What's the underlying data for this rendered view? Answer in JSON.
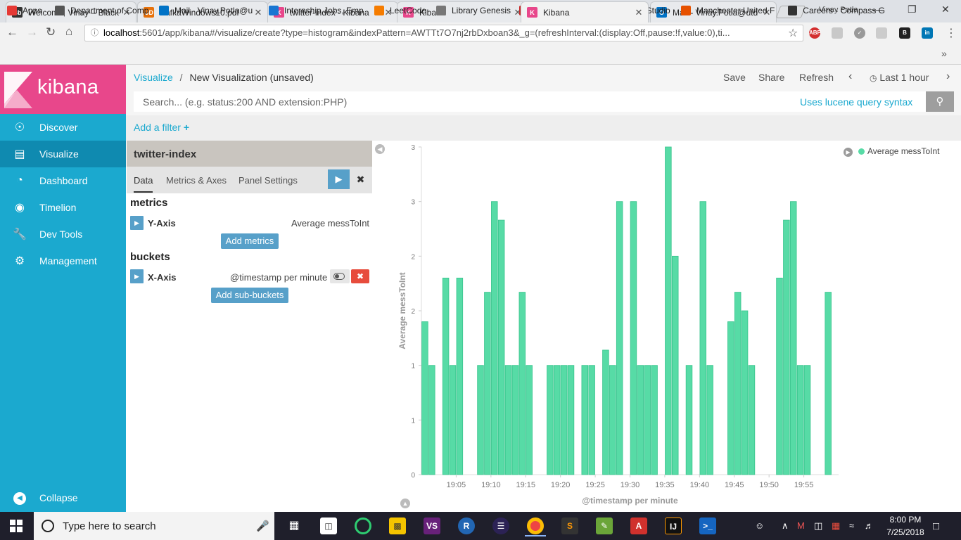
{
  "browser": {
    "tabs": [
      {
        "title": "Welcome, Vinay – Black",
        "icon": "Bb",
        "color": "#333333"
      },
      {
        "title": "KafkaWindows10.pdf",
        "icon": "UD",
        "color": "#e8710a"
      },
      {
        "title": "twitter-index - Kibana",
        "icon": "K",
        "color": "#e8478b"
      },
      {
        "title": "Kibana",
        "icon": "K",
        "color": "#e8478b"
      },
      {
        "title": "Kibana",
        "icon": "K",
        "color": "#e8478b"
      },
      {
        "title": "Mail - Vinay.Potla@utd",
        "icon": "O",
        "color": "#0072c6"
      }
    ],
    "profile_name": "Vinay Potla",
    "url_host": "localhost",
    "url_rest": ":5601/app/kibana#/visualize/create?type=histogram&indexPattern=AWTTt7O7nj2rbDxboan3&_g=(refreshInterval:(display:Off,pause:!f,value:0),ti...",
    "bookmarks": [
      {
        "label": "Apps"
      },
      {
        "label": "Department of Comp"
      },
      {
        "label": "Mail - Vinay.Potla@u"
      },
      {
        "label": "Internship Jobs, Emp"
      },
      {
        "label": "LeetCode"
      },
      {
        "label": "Library Genesis"
      },
      {
        "label": "Online Courses - Any"
      },
      {
        "label": "RStudio"
      },
      {
        "label": "Manchester United F"
      },
      {
        "label": "Careers - Compass G"
      }
    ]
  },
  "kibana": {
    "logo_text": "kibana",
    "nav": [
      {
        "label": "Discover",
        "icon": "compass-icon"
      },
      {
        "label": "Visualize",
        "icon": "bar-chart-icon"
      },
      {
        "label": "Dashboard",
        "icon": "dashboard-icon"
      },
      {
        "label": "Timelion",
        "icon": "timelion-icon"
      },
      {
        "label": "Dev Tools",
        "icon": "wrench-icon"
      },
      {
        "label": "Management",
        "icon": "gear-icon"
      }
    ],
    "collapse_label": "Collapse",
    "breadcrumb": {
      "root": "Visualize",
      "separator": "/",
      "current": "New Visualization (unsaved)"
    },
    "menu": {
      "save": "Save",
      "share": "Share",
      "refresh": "Refresh",
      "time": "Last 1 hour"
    },
    "search_placeholder": "Search... (e.g. status:200 AND extension:PHP)",
    "lucene_link": "Uses lucene query syntax",
    "add_filter": "Add a filter",
    "index_title": "twitter-index",
    "editor_tabs": [
      "Data",
      "Metrics & Axes",
      "Panel Settings"
    ],
    "metrics": {
      "heading": "metrics",
      "agg_label": "Y-Axis",
      "agg_value": "Average messToInt",
      "add_button": "Add metrics"
    },
    "buckets": {
      "heading": "buckets",
      "agg_label": "X-Axis",
      "agg_value": "@timestamp per minute",
      "add_button": "Add sub-buckets"
    }
  },
  "chart_data": {
    "type": "bar",
    "ylabel": "Average messToInt",
    "xlabel": "@timestamp per minute",
    "legend": [
      {
        "name": "Average messToInt",
        "color": "#57dba6"
      }
    ],
    "legend_position": "top-right",
    "ylim": [
      0,
      3
    ],
    "y_ticks": [
      "0",
      "1",
      "1",
      "2",
      "2",
      "3",
      "3"
    ],
    "x_ticks": [
      "19:05",
      "19:10",
      "19:15",
      "19:20",
      "19:25",
      "19:30",
      "19:35",
      "19:40",
      "19:45",
      "19:50",
      "19:55"
    ],
    "bar_color": "#57dba6",
    "x_minutes": [
      0,
      1,
      3,
      4,
      5,
      8,
      9,
      10,
      11,
      12,
      13,
      14,
      15,
      18,
      19,
      20,
      21,
      23,
      24,
      26,
      27,
      28,
      30,
      31,
      32,
      33,
      35,
      36,
      38,
      40,
      41,
      44,
      45,
      46,
      47,
      51,
      52,
      53,
      54,
      55,
      58
    ],
    "values": [
      1.4,
      1.0,
      1.8,
      1.0,
      1.8,
      1.0,
      1.67,
      2.5,
      2.33,
      1.0,
      1.0,
      1.67,
      1.0,
      1.0,
      1.0,
      1.0,
      1.0,
      1.0,
      1.0,
      1.14,
      1.0,
      2.5,
      2.5,
      1.0,
      1.0,
      1.0,
      3.0,
      2.0,
      1.0,
      2.5,
      1.0,
      1.4,
      1.67,
      1.5,
      1.0,
      1.8,
      2.33,
      2.5,
      1.0,
      1.0,
      1.67
    ]
  },
  "taskbar": {
    "search_placeholder": "Type here to search",
    "time": "8:00 PM",
    "date": "7/25/2018"
  }
}
